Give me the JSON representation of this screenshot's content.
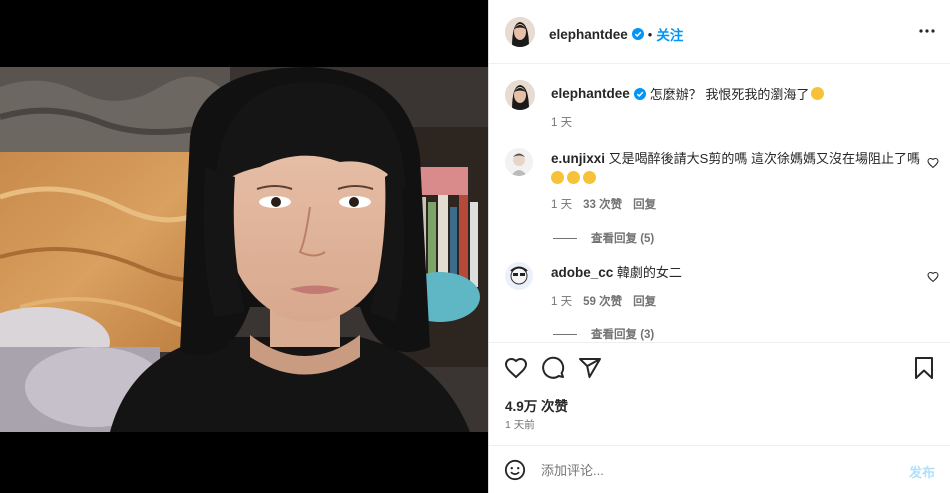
{
  "header": {
    "username": "elephantdee",
    "follow_label": "关注",
    "more_icon": "more-horizontal-icon"
  },
  "caption": {
    "username": "elephantdee",
    "text": "怎麼辦？ 我恨死我的瀏海了",
    "time": "1 天"
  },
  "comments": [
    {
      "username": "e.unjixxi",
      "text": "又是喝醉後請大S剪的嗎 這次徐媽媽又沒在場阻止了嗎",
      "time": "1 天",
      "likes": "33 次赞",
      "reply_label": "回复",
      "view_replies": "查看回复 (5)"
    },
    {
      "username": "adobe_cc",
      "text": "韓劇的女二",
      "time": "1 天",
      "likes": "59 次赞",
      "reply_label": "回复",
      "view_replies": "查看回复 (3)"
    }
  ],
  "actions": {
    "like_icon": "heart-icon",
    "comment_icon": "comment-icon",
    "share_icon": "send-icon",
    "save_icon": "bookmark-icon"
  },
  "stats": {
    "likes": "4.9万 次赞",
    "time": "1 天前"
  },
  "composer": {
    "emoji_icon": "smiley-icon",
    "placeholder": "添加评论...",
    "post_label": "发布"
  },
  "colors": {
    "accent": "#0095f6",
    "verified": "#0095f6",
    "muted": "#737373"
  }
}
